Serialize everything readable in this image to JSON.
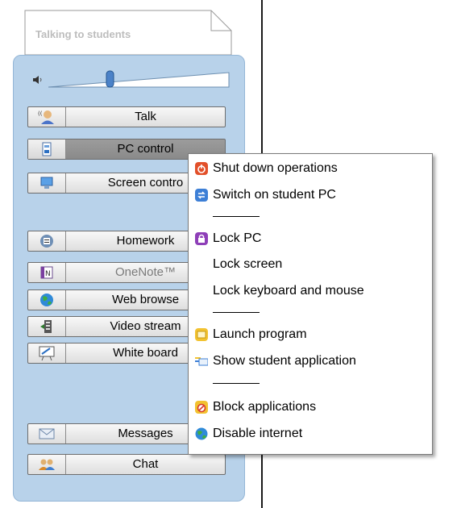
{
  "note": {
    "title": "Talking to students"
  },
  "sidebar": {
    "buttons": [
      {
        "label": "Talk",
        "icon": "talk-icon"
      },
      {
        "label": "PC control",
        "icon": "pc-control-icon",
        "active": true
      },
      {
        "label": "Screen contro",
        "icon": "screen-control-icon"
      },
      {
        "label": "Homework",
        "icon": "homework-icon"
      },
      {
        "label": "OneNote™",
        "icon": "onenote-icon",
        "disabled": true
      },
      {
        "label": "Web browse",
        "icon": "web-browser-icon"
      },
      {
        "label": "Video stream",
        "icon": "video-stream-icon"
      },
      {
        "label": "White board",
        "icon": "white-board-icon"
      },
      {
        "label": "Messages",
        "icon": "messages-icon"
      },
      {
        "label": "Chat",
        "icon": "chat-icon"
      }
    ]
  },
  "menu": {
    "items": [
      {
        "label": "Shut down operations",
        "icon": "shutdown-icon"
      },
      {
        "label": "Switch on student PC",
        "icon": "switch-on-icon"
      },
      {
        "label": "Lock PC",
        "icon": "lock-icon"
      },
      {
        "label": "Lock screen",
        "icon": ""
      },
      {
        "label": "Lock keyboard and mouse",
        "icon": ""
      },
      {
        "label": "Launch program",
        "icon": "launch-program-icon"
      },
      {
        "label": "Show student application",
        "icon": "show-application-icon"
      },
      {
        "label": "Block applications",
        "icon": "block-applications-icon"
      },
      {
        "label": "Disable internet",
        "icon": "globe-icon"
      }
    ]
  }
}
